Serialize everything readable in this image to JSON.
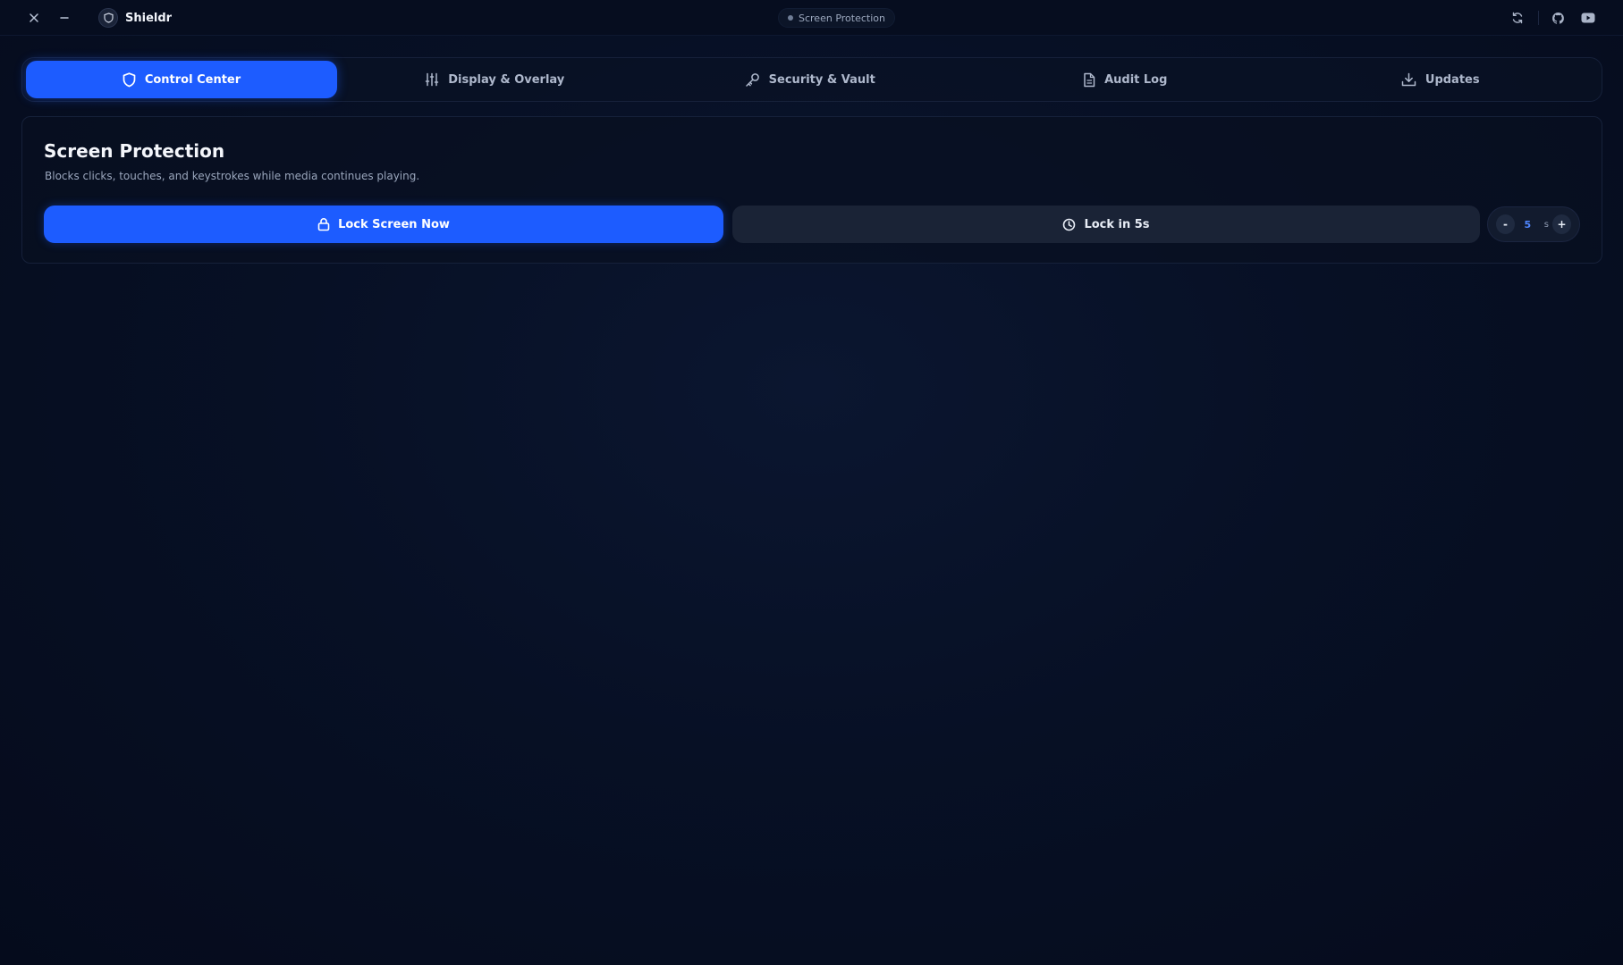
{
  "app": {
    "name": "Shieldr",
    "status_label": "Screen Protection"
  },
  "titlebar": {
    "icons": [
      "close-icon",
      "minimize-icon",
      "shield-logo-icon",
      "refresh-icon",
      "github-icon",
      "youtube-icon"
    ]
  },
  "tabs": [
    {
      "label": "Control Center",
      "icon": "shield-icon",
      "active": true
    },
    {
      "label": "Display & Overlay",
      "icon": "sliders-icon",
      "active": false
    },
    {
      "label": "Security & Vault",
      "icon": "key-icon",
      "active": false
    },
    {
      "label": "Audit Log",
      "icon": "document-icon",
      "active": false
    },
    {
      "label": "Updates",
      "icon": "download-icon",
      "active": false
    }
  ],
  "protection": {
    "title": "Screen Protection",
    "subtitle": "Blocks clicks, touches, and keystrokes while media continues playing.",
    "lock_now_label": "Lock Screen Now",
    "lock_delay_label": "Lock in 5s",
    "delay_value": "5",
    "delay_unit": "s",
    "decrement_label": "-",
    "increment_label": "+"
  },
  "colors": {
    "accent": "#1d5cff",
    "background": "#071025",
    "secondary_button": "#1a2336"
  }
}
